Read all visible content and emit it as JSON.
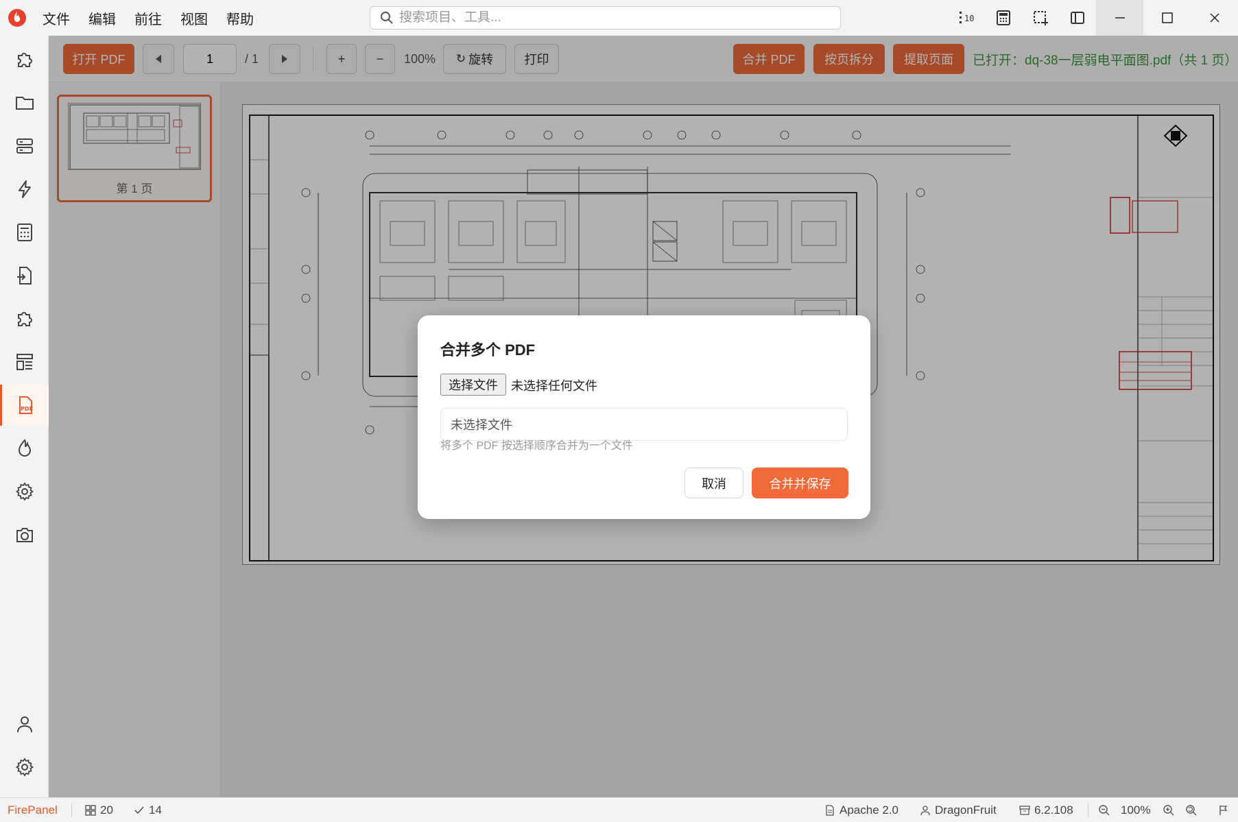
{
  "menu": [
    "文件",
    "编辑",
    "前往",
    "视图",
    "帮助"
  ],
  "search": {
    "placeholder": "搜索项目、工具..."
  },
  "toolbar": {
    "open_pdf": "打开 PDF",
    "page_current": "1",
    "page_total": "/ 1",
    "zoom_in": "+",
    "zoom_out": "−",
    "zoom_level": "100%",
    "rotate": "旋转",
    "print": "打印",
    "merge_pdf": "合并 PDF",
    "split_pages": "按页拆分",
    "extract_pages": "提取页面",
    "opened_file": "已打开：dq-38一层弱电平面图.pdf（共 1 页）"
  },
  "thumbnails": [
    {
      "label": "第 1 页"
    }
  ],
  "dialog": {
    "title": "合并多个 PDF",
    "choose_file": "选择文件",
    "no_file_chosen": "未选择任何文件",
    "file_list_empty": "未选择文件",
    "hint": "将多个 PDF 按选择顺序合并为一个文件",
    "cancel": "取消",
    "confirm": "合并并保存"
  },
  "statusbar": {
    "brand": "FirePanel",
    "count_a": "20",
    "count_b": "14",
    "license": "Apache 2.0",
    "user": "DragonFruit",
    "version": "6.2.108",
    "zoom": "100%"
  },
  "colors": {
    "accent": "#ee6a3b",
    "opened_text": "#3a9a3a",
    "stamp_red": "#d42020"
  }
}
